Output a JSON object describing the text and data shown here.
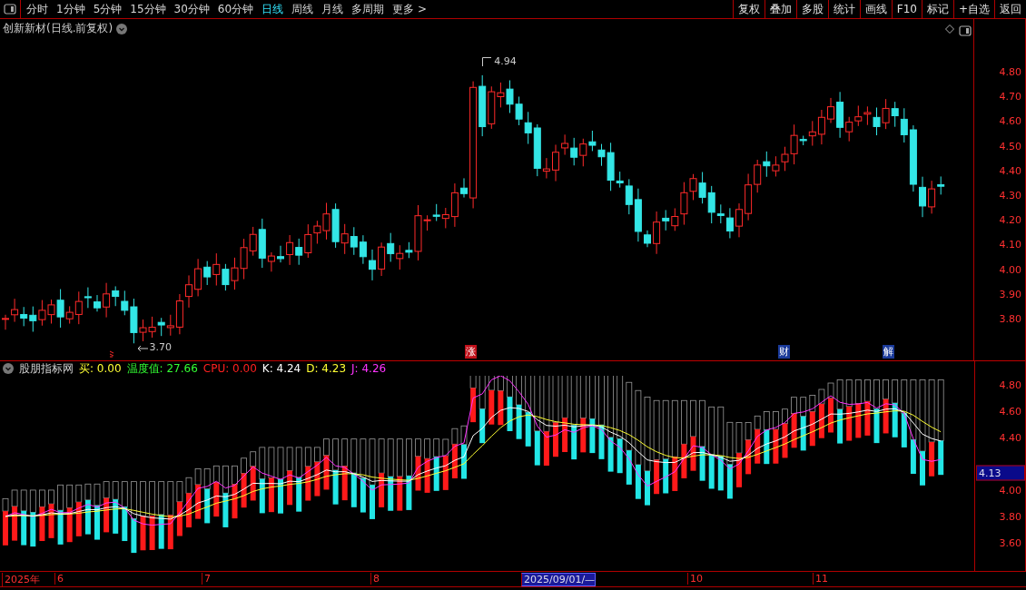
{
  "toolbar": {
    "periods": [
      {
        "label": "分时",
        "selected": false
      },
      {
        "label": "1分钟",
        "selected": false
      },
      {
        "label": "5分钟",
        "selected": false
      },
      {
        "label": "15分钟",
        "selected": false
      },
      {
        "label": "30分钟",
        "selected": false
      },
      {
        "label": "60分钟",
        "selected": false
      },
      {
        "label": "日线",
        "selected": true
      },
      {
        "label": "周线",
        "selected": false
      },
      {
        "label": "月线",
        "selected": false
      },
      {
        "label": "多周期",
        "selected": false
      },
      {
        "label": "更多 >",
        "selected": false
      }
    ],
    "buttons": [
      "复权",
      "叠加",
      "多股",
      "统计",
      "画线",
      "F10",
      "标记",
      "+自选",
      "返回"
    ]
  },
  "main_chart": {
    "title": "创新新材(日线.前复权)",
    "high_label": "4.94",
    "low_label": "3.70",
    "events": [
      {
        "label": "涨",
        "color": "#c0101a"
      },
      {
        "label": "财",
        "color": "#1a3a9a"
      },
      {
        "label": "解",
        "color": "#1a3a9a"
      }
    ],
    "y_axis": [
      "4.80",
      "4.70",
      "4.60",
      "4.50",
      "4.40",
      "4.30",
      "4.20",
      "4.10",
      "4.00",
      "3.90",
      "3.80"
    ]
  },
  "indicator": {
    "title": "股朋指标网",
    "legend": [
      {
        "text": "买: 0.00",
        "color": "#ffff33"
      },
      {
        "text": "温度值: 27.66",
        "color": "#33ff33"
      },
      {
        "text": "CPU: 0.00",
        "color": "#ff2020"
      },
      {
        "text": "K: 4.24",
        "color": "#ffffff"
      },
      {
        "text": "D: 4.23",
        "color": "#ffff33"
      },
      {
        "text": "J: 4.26",
        "color": "#ff33ff"
      }
    ],
    "y_axis": [
      "4.80",
      "4.60",
      "4.40",
      "4.00",
      "3.80",
      "3.60"
    ],
    "current_value": "4.13"
  },
  "x_axis": [
    {
      "label": "2025年",
      "selected": false
    },
    {
      "label": "6",
      "selected": false
    },
    {
      "label": "7",
      "selected": false
    },
    {
      "label": "8",
      "selected": false
    },
    {
      "label": "2025/09/01/—",
      "selected": true
    },
    {
      "label": "10",
      "selected": false
    },
    {
      "label": "11",
      "selected": false
    }
  ]
}
